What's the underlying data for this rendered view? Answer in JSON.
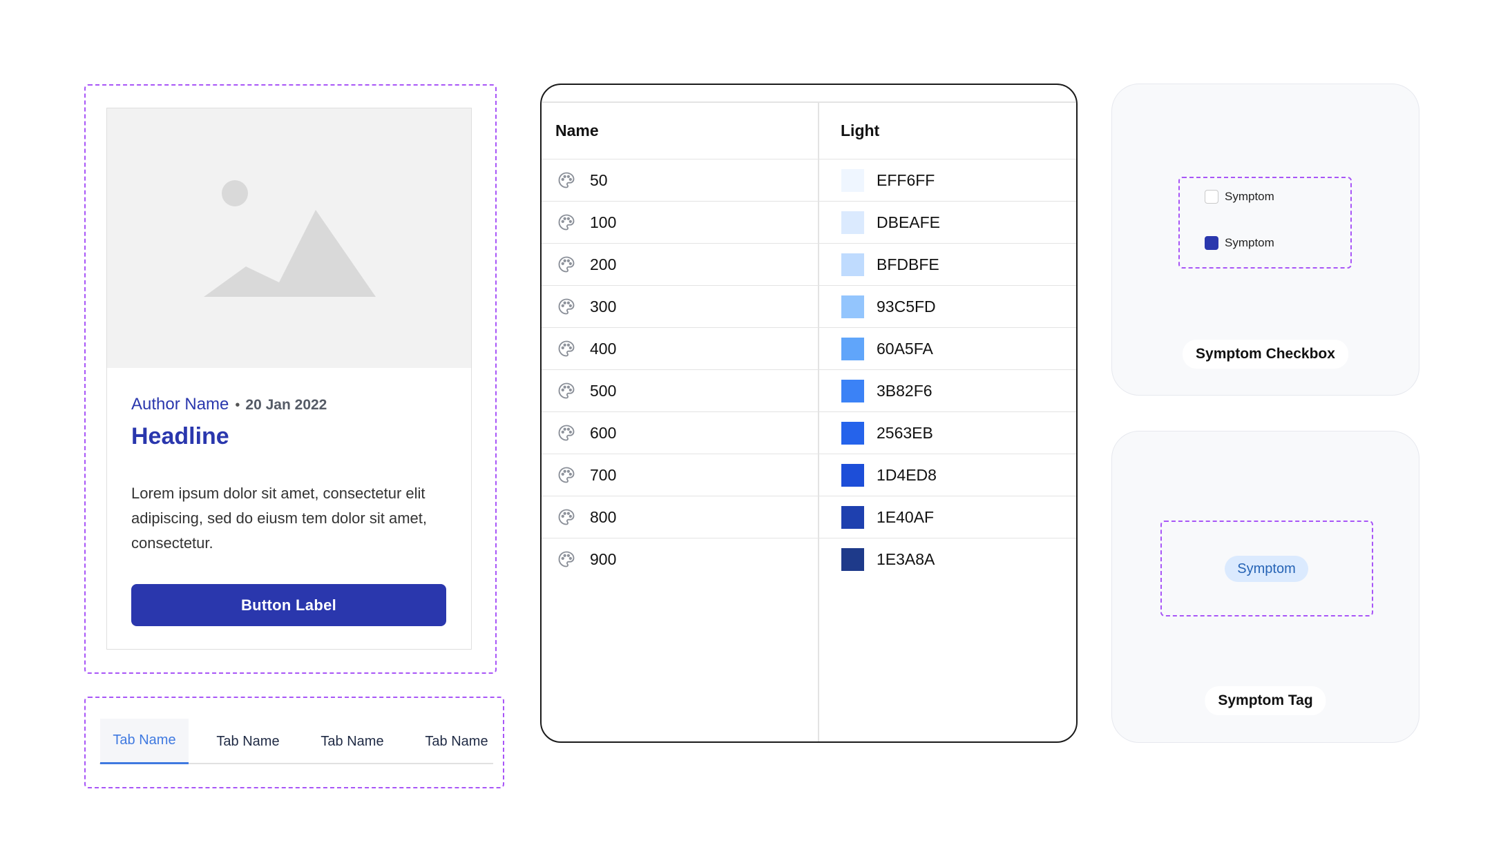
{
  "card": {
    "author": "Author Name",
    "separator": "•",
    "date": "20 Jan 2022",
    "headline": "Headline",
    "body": "Lorem ipsum dolor sit amet, consectetur elit adipiscing, sed do eiusm tem dolor sit amet, consectetur.",
    "button_label": "Button Label",
    "image_icon": "image-placeholder-icon"
  },
  "tabs": {
    "active_index": 0,
    "items": [
      {
        "label": "Tab Name"
      },
      {
        "label": "Tab Name"
      },
      {
        "label": "Tab Name"
      },
      {
        "label": "Tab Name"
      }
    ]
  },
  "color_table": {
    "headers": {
      "name": "Name",
      "light": "Light"
    },
    "row_icon": "palette-icon",
    "rows": [
      {
        "name": "50",
        "hex": "EFF6FF",
        "color": "#EFF6FF"
      },
      {
        "name": "100",
        "hex": "DBEAFE",
        "color": "#DBEAFE"
      },
      {
        "name": "200",
        "hex": "BFDBFE",
        "color": "#BFDBFE"
      },
      {
        "name": "300",
        "hex": "93C5FD",
        "color": "#93C5FD"
      },
      {
        "name": "400",
        "hex": "60A5FA",
        "color": "#60A5FA"
      },
      {
        "name": "500",
        "hex": "3B82F6",
        "color": "#3B82F6"
      },
      {
        "name": "600",
        "hex": "2563EB",
        "color": "#2563EB"
      },
      {
        "name": "700",
        "hex": "1D4ED8",
        "color": "#1D4ED8"
      },
      {
        "name": "800",
        "hex": "1E40AF",
        "color": "#1E40AF"
      },
      {
        "name": "900",
        "hex": "1E3A8A",
        "color": "#1E3A8A"
      }
    ]
  },
  "symptom_checkbox": {
    "title": "Symptom Checkbox",
    "items": [
      {
        "label": "Symptom",
        "checked": false
      },
      {
        "label": "Symptom",
        "checked": true
      }
    ]
  },
  "symptom_tag": {
    "title": "Symptom Tag",
    "tag_label": "Symptom"
  },
  "colors": {
    "primary": "#2A37AD",
    "tab_active": "#3F79E0",
    "dashed_outline": "#A855F7",
    "tag_bg": "#DBEAFE"
  }
}
